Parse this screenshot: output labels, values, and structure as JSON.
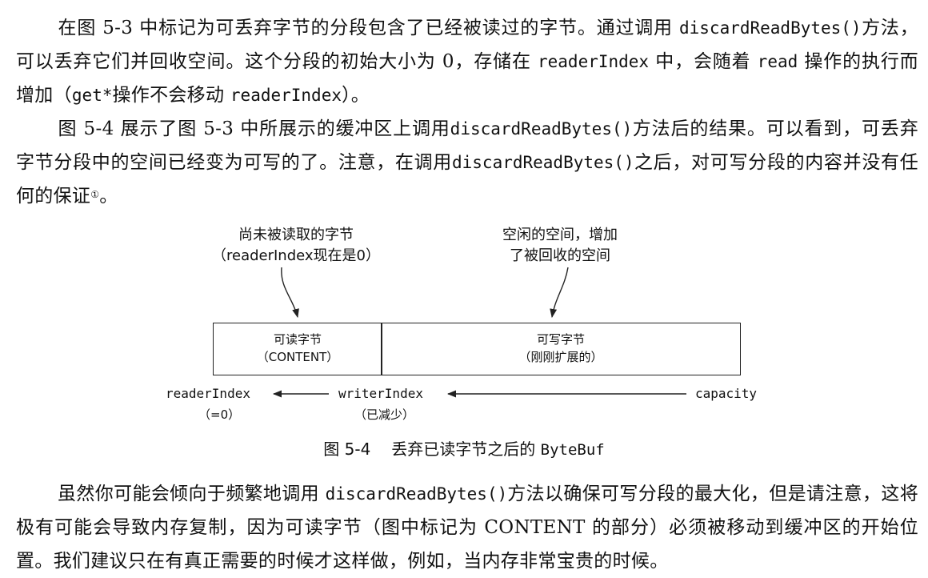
{
  "paragraph1": {
    "t1": "在图 5-3 中标记为可丢弃字节的分段包含了已经被读过的字节。通过调用 ",
    "code1": "discardReadBytes()",
    "t2": "方法，可以丢弃它们并回收空间。这个分段的初始大小为 0，存储在 ",
    "code2": "readerIndex",
    "t3": " 中，会随着 ",
    "code3": "read",
    "t4": " 操作的执行而增加（",
    "code4": "get*",
    "t5": "操作不会移动 ",
    "code5": "readerIndex",
    "t6": "）。"
  },
  "paragraph2": {
    "t1": "图 5-4 展示了图 5-3 中所展示的缓冲区上调用",
    "code1": "discardReadBytes()",
    "t2": "方法后的结果。可以看到，可丢弃字节分段中的空间已经变为可写的了。注意，在调用",
    "code2": "discardReadBytes()",
    "t3": "之后，对可写分段的内容并没有任何的保证",
    "footnote": "①",
    "t4": "。"
  },
  "figure": {
    "label_left_line1": "尚未被读取的字节",
    "label_left_line2": "（readerIndex现在是0）",
    "label_right_line1": "空闲的空间，增加",
    "label_right_line2": "了被回收的空间",
    "box_readable_title": "可读字节",
    "box_readable_sub": "（CONTENT）",
    "box_writable_title": "可写字节",
    "box_writable_sub": "（刚刚扩展的）",
    "reader_index": "readerIndex",
    "reader_index_sub": "（=0）",
    "writer_index": "writerIndex",
    "writer_index_sub": "（已减少）",
    "capacity": "capacity",
    "caption_num": "图 5-4",
    "caption_text": "丢弃已读字节之后的 ",
    "caption_code": "ByteBuf"
  },
  "paragraph3": {
    "t1": "虽然你可能会倾向于频繁地调用 ",
    "code1": "discardReadBytes()",
    "t2": "方法以确保可写分段的最大化，但是请注意，这将极有可能会导致内存复制，因为可读字节（图中标记为 CONTENT 的部分）必须被移动到缓冲区的开始位置。我们建议只在有真正需要的时候才这样做，例如，当内存非常宝贵的时候。"
  }
}
